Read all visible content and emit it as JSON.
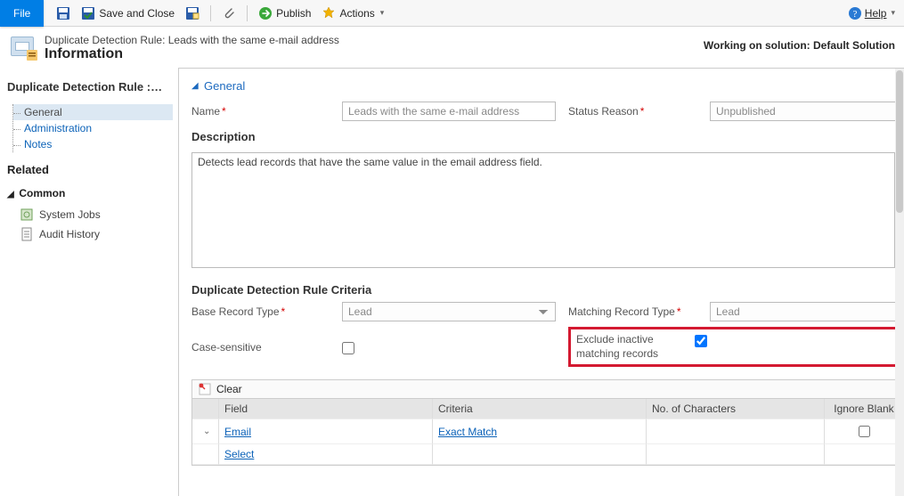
{
  "ribbon": {
    "file": "File",
    "save_close": "Save and Close",
    "publish": "Publish",
    "actions": "Actions",
    "help": "Help"
  },
  "header": {
    "kicker": "Duplicate Detection Rule: Leads with the same e-mail address",
    "title": "Information",
    "solution_label": "Working on solution: Default Solution"
  },
  "leftnav": {
    "rule_title": "Duplicate Detection Rule :…",
    "items": [
      "General",
      "Administration",
      "Notes"
    ],
    "related": "Related",
    "common": "Common",
    "common_items": [
      "System Jobs",
      "Audit History"
    ]
  },
  "general": {
    "section": "General",
    "name_label": "Name",
    "name_value": "Leads with the same e-mail address",
    "status_label": "Status Reason",
    "status_value": "Unpublished",
    "description_label": "Description",
    "description_value": "Detects lead records that have the same value in the email address field."
  },
  "criteria": {
    "heading": "Duplicate Detection Rule Criteria",
    "base_label": "Base Record Type",
    "base_value": "Lead",
    "matching_label": "Matching Record Type",
    "matching_value": "Lead",
    "case_label": "Case-sensitive",
    "case_checked": false,
    "exclude_label": "Exclude inactive matching records",
    "exclude_checked": true,
    "clear": "Clear",
    "cols": {
      "field": "Field",
      "criteria": "Criteria",
      "chars": "No. of Characters",
      "ignore": "Ignore Blank"
    },
    "rows": [
      {
        "field": "Email",
        "criteria": "Exact Match",
        "chars": "",
        "ignore": false
      }
    ],
    "select": "Select"
  }
}
